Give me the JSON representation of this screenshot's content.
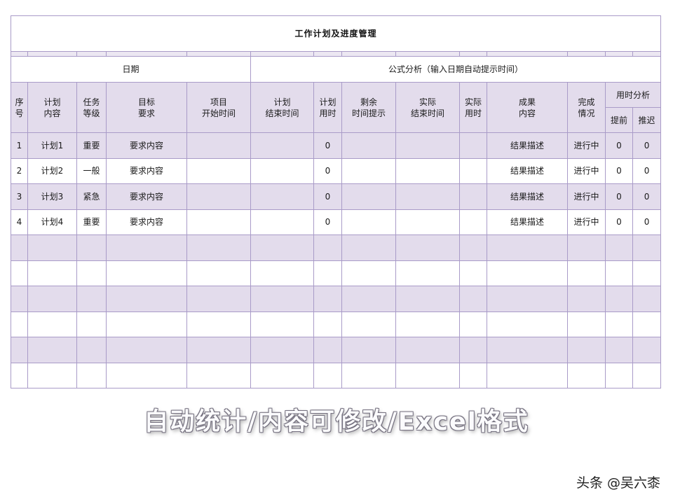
{
  "title": "工作计划及进度管理",
  "sections": {
    "date": "日期",
    "formula": "公式分析（输入日期自动提示时间）"
  },
  "headers": {
    "seq": [
      "序",
      "号"
    ],
    "plan_content": [
      "计划",
      "内容"
    ],
    "task_level": [
      "任务",
      "等级"
    ],
    "goal_req": [
      "目标",
      "要求"
    ],
    "project_start": [
      "项目",
      "开始时间"
    ],
    "plan_end": [
      "计划",
      "结束时间"
    ],
    "plan_used": [
      "计划",
      "用时"
    ],
    "remaining": [
      "剩余",
      "时间提示"
    ],
    "actual_end": [
      "实际",
      "结束时间"
    ],
    "actual_used": [
      "实际",
      "用时"
    ],
    "result": [
      "成果",
      "内容"
    ],
    "completion": [
      "完成",
      "情况"
    ],
    "time_analysis": "用时分析",
    "early": "提前",
    "delay": "推迟"
  },
  "rows": [
    {
      "seq": "1",
      "plan": "计划1",
      "level": "重要",
      "req": "要求内容",
      "plan_used": "0",
      "result": "结果描述",
      "status": "进行中",
      "early": "0",
      "delay": "0"
    },
    {
      "seq": "2",
      "plan": "计划2",
      "level": "一般",
      "req": "要求内容",
      "plan_used": "0",
      "result": "结果描述",
      "status": "进行中",
      "early": "0",
      "delay": "0"
    },
    {
      "seq": "3",
      "plan": "计划3",
      "level": "紧急",
      "req": "要求内容",
      "plan_used": "0",
      "result": "结果描述",
      "status": "进行中",
      "early": "0",
      "delay": "0"
    },
    {
      "seq": "4",
      "plan": "计划4",
      "level": "重要",
      "req": "要求内容",
      "plan_used": "0",
      "result": "结果描述",
      "status": "进行中",
      "early": "0",
      "delay": "0"
    }
  ],
  "promo": "自动统计/内容可修改/Excel格式",
  "watermark": "头条 @吴六桼",
  "colors": {
    "border": "#a99bc8",
    "shade": "#e3dcec"
  }
}
